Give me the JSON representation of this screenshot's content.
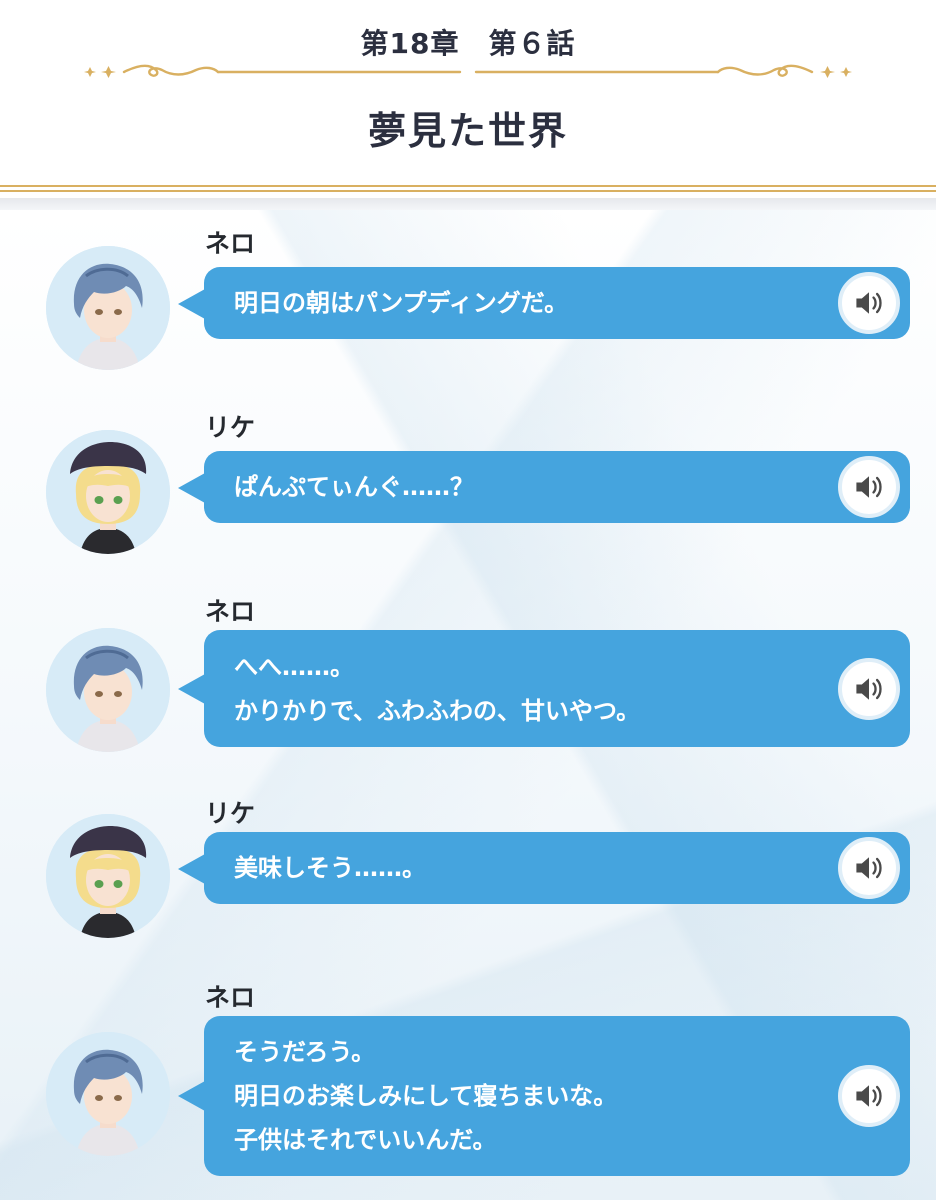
{
  "header": {
    "chapter": "第18章　第６話",
    "episode_title": "夢見た世界"
  },
  "colors": {
    "bubble": "#45a4de",
    "gold": "#d9b061",
    "text_dark": "#2b2f3f"
  },
  "messages": [
    {
      "speaker": "ネロ",
      "character": "nero",
      "lines": [
        "明日の朝はパンプディングだ。"
      ]
    },
    {
      "speaker": "リケ",
      "character": "rike",
      "lines": [
        "ぱんぷてぃんぐ……？"
      ]
    },
    {
      "speaker": "ネロ",
      "character": "nero",
      "lines": [
        "へへ……。",
        "かりかりで、ふわふわの、甘いやつ。"
      ]
    },
    {
      "speaker": "リケ",
      "character": "rike",
      "lines": [
        "美味しそう……。"
      ]
    },
    {
      "speaker": "ネロ",
      "character": "nero",
      "lines": [
        "そうだろう。",
        "明日のお楽しみにして寝ちまいな。",
        "子供はそれでいいんだ。"
      ]
    }
  ],
  "icons": {
    "voice": "speaker-volume-icon",
    "ornament": "gold-flourish-star-divider"
  }
}
